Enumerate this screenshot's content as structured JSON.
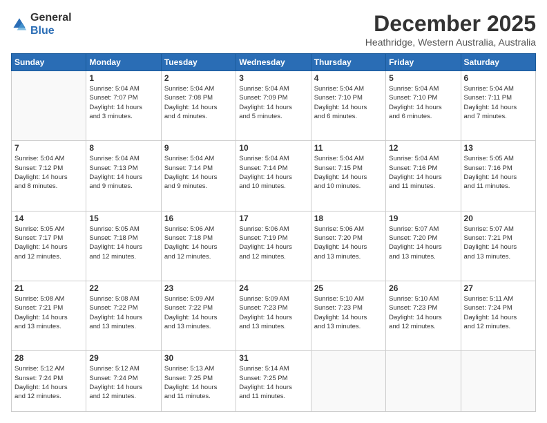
{
  "logo": {
    "general": "General",
    "blue": "Blue"
  },
  "header": {
    "month_title": "December 2025",
    "subtitle": "Heathridge, Western Australia, Australia"
  },
  "days_of_week": [
    "Sunday",
    "Monday",
    "Tuesday",
    "Wednesday",
    "Thursday",
    "Friday",
    "Saturday"
  ],
  "weeks": [
    [
      {
        "day": "",
        "info": ""
      },
      {
        "day": "1",
        "info": "Sunrise: 5:04 AM\nSunset: 7:07 PM\nDaylight: 14 hours\nand 3 minutes."
      },
      {
        "day": "2",
        "info": "Sunrise: 5:04 AM\nSunset: 7:08 PM\nDaylight: 14 hours\nand 4 minutes."
      },
      {
        "day": "3",
        "info": "Sunrise: 5:04 AM\nSunset: 7:09 PM\nDaylight: 14 hours\nand 5 minutes."
      },
      {
        "day": "4",
        "info": "Sunrise: 5:04 AM\nSunset: 7:10 PM\nDaylight: 14 hours\nand 6 minutes."
      },
      {
        "day": "5",
        "info": "Sunrise: 5:04 AM\nSunset: 7:10 PM\nDaylight: 14 hours\nand 6 minutes."
      },
      {
        "day": "6",
        "info": "Sunrise: 5:04 AM\nSunset: 7:11 PM\nDaylight: 14 hours\nand 7 minutes."
      }
    ],
    [
      {
        "day": "7",
        "info": "Sunrise: 5:04 AM\nSunset: 7:12 PM\nDaylight: 14 hours\nand 8 minutes."
      },
      {
        "day": "8",
        "info": "Sunrise: 5:04 AM\nSunset: 7:13 PM\nDaylight: 14 hours\nand 9 minutes."
      },
      {
        "day": "9",
        "info": "Sunrise: 5:04 AM\nSunset: 7:14 PM\nDaylight: 14 hours\nand 9 minutes."
      },
      {
        "day": "10",
        "info": "Sunrise: 5:04 AM\nSunset: 7:14 PM\nDaylight: 14 hours\nand 10 minutes."
      },
      {
        "day": "11",
        "info": "Sunrise: 5:04 AM\nSunset: 7:15 PM\nDaylight: 14 hours\nand 10 minutes."
      },
      {
        "day": "12",
        "info": "Sunrise: 5:04 AM\nSunset: 7:16 PM\nDaylight: 14 hours\nand 11 minutes."
      },
      {
        "day": "13",
        "info": "Sunrise: 5:05 AM\nSunset: 7:16 PM\nDaylight: 14 hours\nand 11 minutes."
      }
    ],
    [
      {
        "day": "14",
        "info": "Sunrise: 5:05 AM\nSunset: 7:17 PM\nDaylight: 14 hours\nand 12 minutes."
      },
      {
        "day": "15",
        "info": "Sunrise: 5:05 AM\nSunset: 7:18 PM\nDaylight: 14 hours\nand 12 minutes."
      },
      {
        "day": "16",
        "info": "Sunrise: 5:06 AM\nSunset: 7:18 PM\nDaylight: 14 hours\nand 12 minutes."
      },
      {
        "day": "17",
        "info": "Sunrise: 5:06 AM\nSunset: 7:19 PM\nDaylight: 14 hours\nand 12 minutes."
      },
      {
        "day": "18",
        "info": "Sunrise: 5:06 AM\nSunset: 7:20 PM\nDaylight: 14 hours\nand 13 minutes."
      },
      {
        "day": "19",
        "info": "Sunrise: 5:07 AM\nSunset: 7:20 PM\nDaylight: 14 hours\nand 13 minutes."
      },
      {
        "day": "20",
        "info": "Sunrise: 5:07 AM\nSunset: 7:21 PM\nDaylight: 14 hours\nand 13 minutes."
      }
    ],
    [
      {
        "day": "21",
        "info": "Sunrise: 5:08 AM\nSunset: 7:21 PM\nDaylight: 14 hours\nand 13 minutes."
      },
      {
        "day": "22",
        "info": "Sunrise: 5:08 AM\nSunset: 7:22 PM\nDaylight: 14 hours\nand 13 minutes."
      },
      {
        "day": "23",
        "info": "Sunrise: 5:09 AM\nSunset: 7:22 PM\nDaylight: 14 hours\nand 13 minutes."
      },
      {
        "day": "24",
        "info": "Sunrise: 5:09 AM\nSunset: 7:23 PM\nDaylight: 14 hours\nand 13 minutes."
      },
      {
        "day": "25",
        "info": "Sunrise: 5:10 AM\nSunset: 7:23 PM\nDaylight: 14 hours\nand 13 minutes."
      },
      {
        "day": "26",
        "info": "Sunrise: 5:10 AM\nSunset: 7:23 PM\nDaylight: 14 hours\nand 12 minutes."
      },
      {
        "day": "27",
        "info": "Sunrise: 5:11 AM\nSunset: 7:24 PM\nDaylight: 14 hours\nand 12 minutes."
      }
    ],
    [
      {
        "day": "28",
        "info": "Sunrise: 5:12 AM\nSunset: 7:24 PM\nDaylight: 14 hours\nand 12 minutes."
      },
      {
        "day": "29",
        "info": "Sunrise: 5:12 AM\nSunset: 7:24 PM\nDaylight: 14 hours\nand 12 minutes."
      },
      {
        "day": "30",
        "info": "Sunrise: 5:13 AM\nSunset: 7:25 PM\nDaylight: 14 hours\nand 11 minutes."
      },
      {
        "day": "31",
        "info": "Sunrise: 5:14 AM\nSunset: 7:25 PM\nDaylight: 14 hours\nand 11 minutes."
      },
      {
        "day": "",
        "info": ""
      },
      {
        "day": "",
        "info": ""
      },
      {
        "day": "",
        "info": ""
      }
    ]
  ]
}
